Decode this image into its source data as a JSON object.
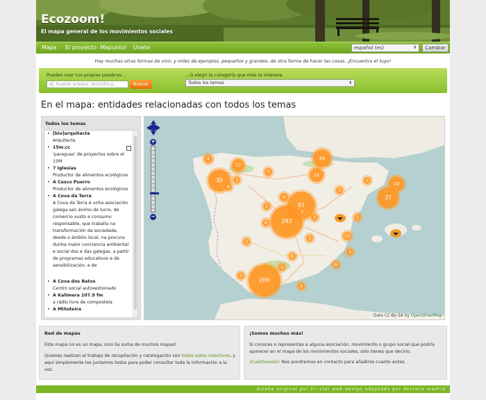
{
  "header": {
    "title": "Ecozoom!",
    "subtitle": "El mapa general de los movimientos sociales"
  },
  "nav": {
    "items": [
      "Mapa",
      "El proyecto: Mapunto!",
      "Únete"
    ],
    "language_value": "español (es)",
    "change_button": "Cambiar"
  },
  "tagline": "Hay muchas otras formas de vivir, y miles de ejemplos, pequeños y grandes, de otra forma de hacer las cosas. ¡Encuentra el tuyo!",
  "search": {
    "label": "Puedes usar tus propias palabras...",
    "placeholder": "ej. huerto urbano, bicicrítica...",
    "button": "Buscar",
    "category_label": "...O elegir la categoría que más te interesa",
    "category_value": "Todos los temas"
  },
  "section_title": "En el mapa: entidades relacionadas con todos los temas",
  "list": {
    "heading": "Todos los temas",
    "entries": [
      {
        "name": "[bio]arquitecta",
        "desc": "Arquitecta"
      },
      {
        "name": "15m.cc",
        "desc": "'paraguas' de proyectos sobre el 15M"
      },
      {
        "name": "7 Iglesias",
        "desc": "Productor de alimentos ecológicos"
      },
      {
        "name": "A Casco Puerro",
        "desc": "Productor de alimentos ecológicos"
      },
      {
        "name": "A Cova da Terra",
        "desc": "A Cova da Terra é unha asociación galega sen ánimo de lucro, de comercio xusto e consumo responsable, que traballa na transformación da sociedade, desde o ámbito local, na procura dunha maior conciencia ambiental e social dos e das galegas, a partir de programas educativos e de sensibilización; e de"
      },
      {
        "name": "A Cova dos Ratos",
        "desc": "Centro social autoxestionado"
      },
      {
        "name": "A Kalimera 107.9 fm",
        "desc": "a rádio livre de compostela"
      },
      {
        "name": "A Miñoteira",
        "desc": ""
      }
    ]
  },
  "map": {
    "clusters": [
      "4",
      "17",
      "35",
      "29",
      "22",
      "23",
      "37",
      "3",
      "9",
      "61",
      "283",
      "209",
      "3",
      "6",
      "3",
      "2",
      "6",
      "3",
      "3",
      "3",
      "10",
      "3",
      "6",
      "3",
      "3",
      "2",
      "6",
      "3",
      "3",
      "2"
    ],
    "attribution_prefix": "Data CC-By-SA by",
    "attribution_link": "OpenStreetMap"
  },
  "box_left": {
    "title": "Red de mapas",
    "p1": "Este mapa no es un mapa, sino ila suma de muchos mapas!",
    "p2_before": "Quienes realizan el trabajo de recopilación y catalogación son",
    "p2_link": "todos estos colectivos",
    "p2_after": ", y aquí simplemente los juntamos todos para poder consultar toda la información a la vez."
  },
  "box_right": {
    "title": "¡Somos muchos más!",
    "p1": "Si conoces o representas a alguna asociación, movimiento o grupo social que podría aparecer en el mapa de los movimientos sociales, sólo tienes que decirlo.",
    "p2_link": "¡Cuéntanoslo!",
    "p2_after": " Nos pondremos en contacto para añadiros cuanto antes."
  },
  "footer": "diseño original por tri-star web design adaptado por decrece madrid",
  "colors": {
    "nav_green": "#7ab625",
    "cluster_orange": "#ff9623",
    "search_orange": "#e66f06",
    "sea": "#b5d0d0"
  }
}
